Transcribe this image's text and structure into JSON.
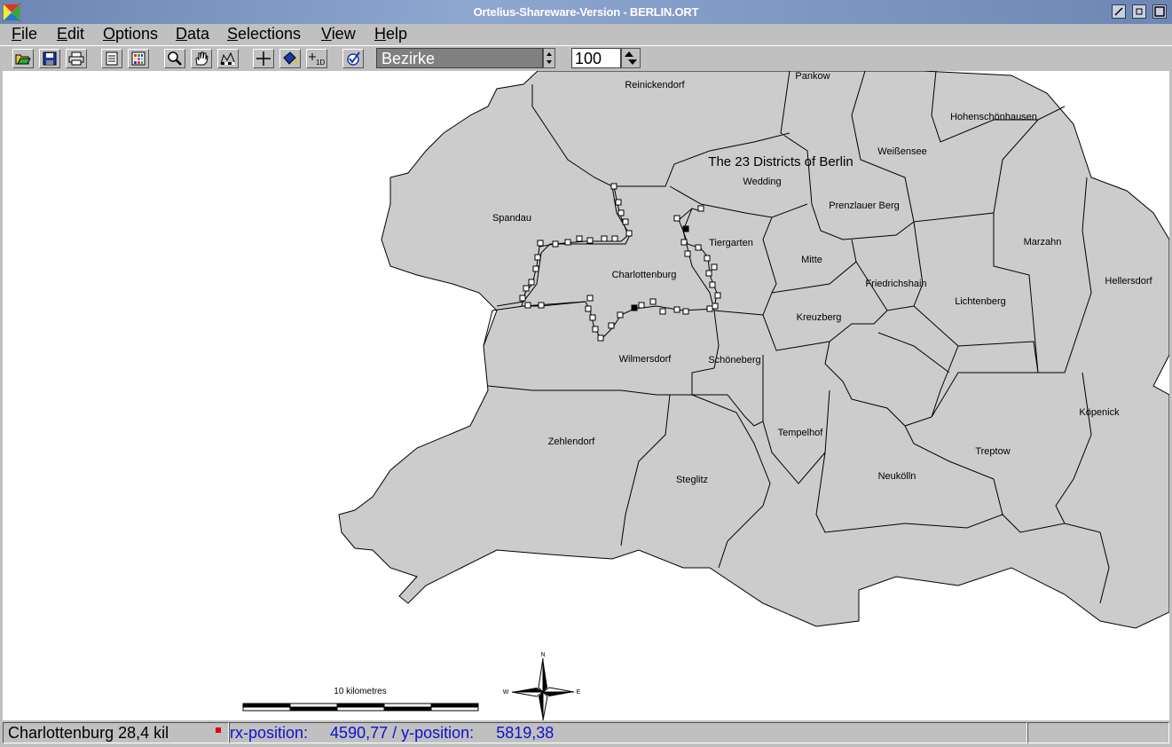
{
  "window": {
    "title": "Ortelius-Shareware-Version - BERLIN.ORT"
  },
  "menu": [
    {
      "label": "File",
      "underline": "F",
      "rest": "ile"
    },
    {
      "label": "Edit",
      "underline": "E",
      "rest": "dit"
    },
    {
      "label": "Options",
      "underline": "O",
      "rest": "ptions"
    },
    {
      "label": "Data",
      "underline": "D",
      "rest": "ata"
    },
    {
      "label": "Selections",
      "underline": "S",
      "rest": "elections"
    },
    {
      "label": "View",
      "underline": "V",
      "rest": "iew"
    },
    {
      "label": "Help",
      "underline": "H",
      "rest": "elp"
    }
  ],
  "toolbar": {
    "layer_value": "Bezirke",
    "zoom_value": "100",
    "icons": [
      "open-icon",
      "save-icon",
      "print-icon",
      "list-icon",
      "grid-icon",
      "zoom-icon",
      "pan-hand-icon",
      "scale-icon",
      "crosshair-icon",
      "fill-bucket-icon",
      "add-label-icon",
      "check-icon"
    ]
  },
  "map": {
    "title": "The 23 Districts of Berlin",
    "districts": [
      "Reinickendorf",
      "Pankow",
      "Hohenschönhausen",
      "Weißensee",
      "Wedding",
      "Spandau",
      "Prenzlauer Berg",
      "Tiergarten",
      "Marzahn",
      "Mitte",
      "Charlottenburg",
      "Friedrichshain",
      "Hellersdorf",
      "Lichtenberg",
      "Kreuzberg",
      "Wilmersdorf",
      "Schöneberg",
      "Köpenick",
      "Tempelhof",
      "Zehlendorf",
      "Treptow",
      "Steglitz",
      "Neukölln"
    ],
    "scale_label": "10 kilometres",
    "compass": {
      "n": "N",
      "e": "E",
      "w": "W"
    },
    "colors": {
      "district_fill": "#cccccc",
      "border": "#000000",
      "background": "#ffffff"
    }
  },
  "status": {
    "left": "Charlottenburg 28,4 kil",
    "x_label": "rx-position:",
    "x_value": "4590,77",
    "y_label": "/ y-position:",
    "y_value": "5819,38"
  }
}
